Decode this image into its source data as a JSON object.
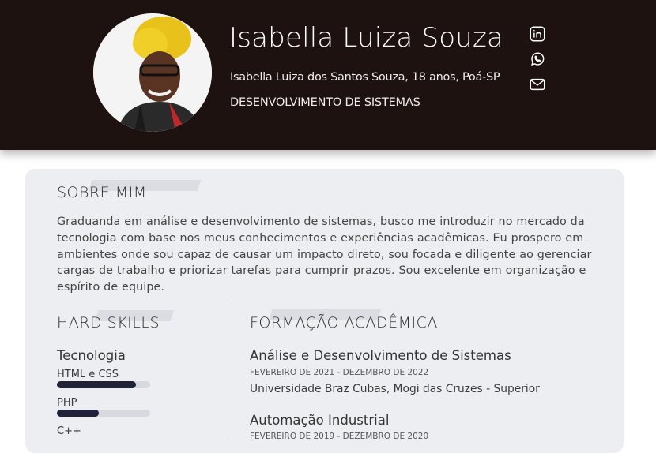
{
  "header": {
    "name": "Isabella Luiza Souza",
    "subtitle": "Isabella Luiza dos Santos Souza, 18 anos, Poá-SP",
    "role": "DESENVOLVIMENTO DE SISTEMAS",
    "social": [
      {
        "icon": "linkedin-icon"
      },
      {
        "icon": "whatsapp-icon"
      },
      {
        "icon": "mail-icon"
      }
    ],
    "background_color": "#1e1210"
  },
  "about": {
    "title": "SOBRE MIM",
    "text": "Graduanda em análise e desenvolvimento de sistemas, busco me introduzir no mercado da tecnologia com base nos meus conhecimentos e experiências acadêmicas. Eu prospero em ambientes onde sou capaz de causar um impacto direto, sou focada e diligente ao gerenciar cargas de trabalho e priorizar tarefas para cumprir prazos. Sou excelente em organização e espírito de equipe."
  },
  "skills": {
    "title": "HARD SKILLS",
    "group": "Tecnologia",
    "items": [
      {
        "label": "HTML e CSS",
        "level": 0.85
      },
      {
        "label": "PHP",
        "level": 0.45
      },
      {
        "label": "C++"
      }
    ],
    "bar_color": "#20223a"
  },
  "education": {
    "title": "FORMAÇÃO ACADÊMICA",
    "items": [
      {
        "course": "Análise e Desenvolvimento de Sistemas",
        "dates": "FEVEREIRO DE 2021 - DEZEMBRO DE 2022",
        "institution": "Universidade Braz Cubas, Mogi das Cruzes - Superior"
      },
      {
        "course": "Automação Industrial",
        "dates": "FEVEREIRO DE 2019 - DEZEMBRO DE 2020"
      }
    ]
  }
}
